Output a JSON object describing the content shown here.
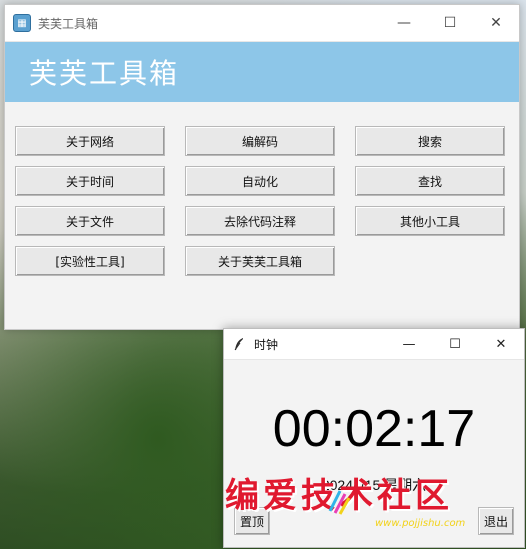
{
  "main_window": {
    "title": "芙芙工具箱",
    "header": "芙芙工具箱",
    "controls": {
      "minimize": "—",
      "maximize": "☐",
      "close": "✕"
    },
    "buttons": [
      {
        "label": "关于网络"
      },
      {
        "label": "编解码"
      },
      {
        "label": "搜索"
      },
      {
        "label": "关于时间"
      },
      {
        "label": "自动化"
      },
      {
        "label": "查找"
      },
      {
        "label": "关于文件"
      },
      {
        "label": "去除代码注释"
      },
      {
        "label": "其他小工具"
      },
      {
        "label": "[实验性工具]"
      },
      {
        "label": "关于芙芙工具箱"
      }
    ]
  },
  "clock_window": {
    "title": "时钟",
    "controls": {
      "minimize": "—",
      "maximize": "☐",
      "close": "✕"
    },
    "time": "00:02:17",
    "date": "2024/  /15 星期六",
    "pin_label": "置顶",
    "exit_label": "退出"
  },
  "watermark": {
    "main_text": "编爱技术社区",
    "url": "www.pojjishu.com"
  }
}
